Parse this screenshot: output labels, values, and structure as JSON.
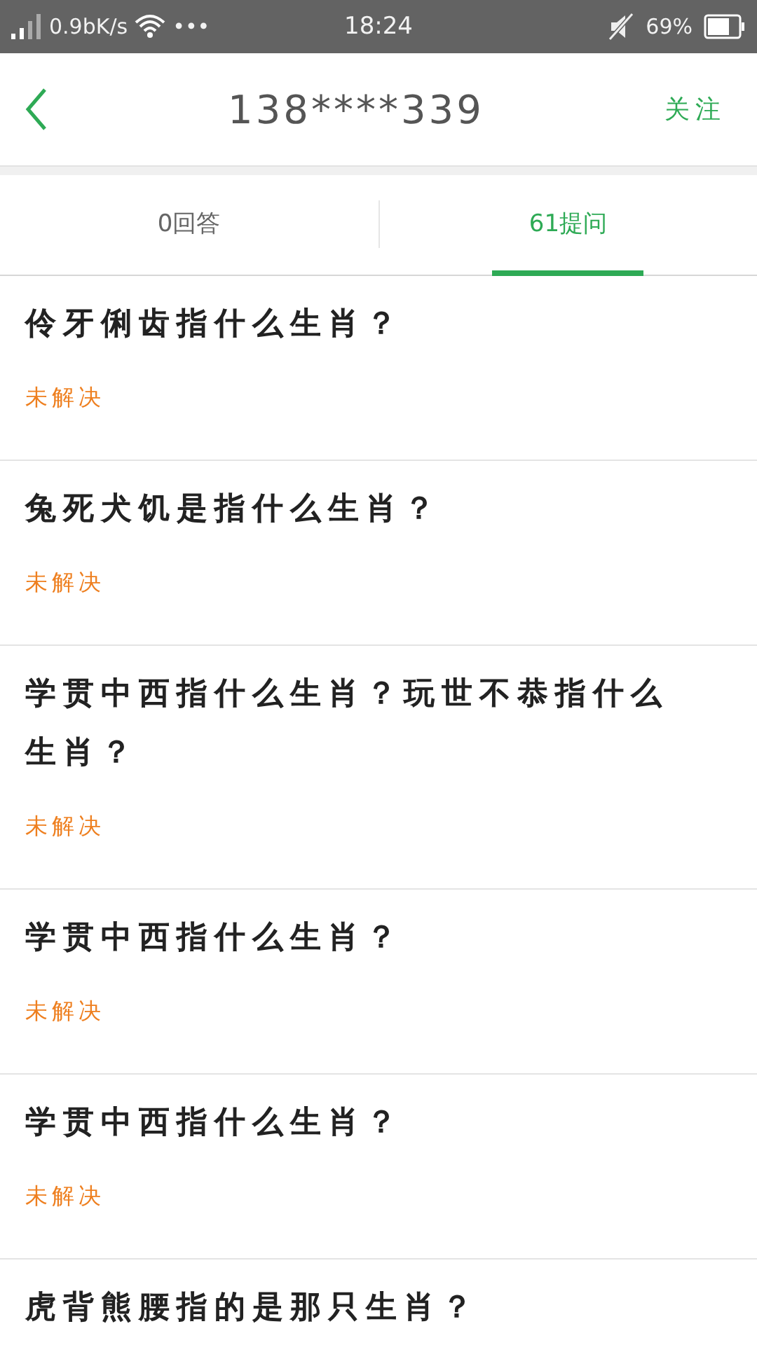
{
  "status_bar": {
    "network_speed": "0.9bK/s",
    "more": "•••",
    "time": "18:24",
    "battery": "69%"
  },
  "header": {
    "title": "138****339",
    "action": "关注"
  },
  "tabs": [
    {
      "label": "0回答",
      "selected": false
    },
    {
      "label": "61提问",
      "selected": true
    }
  ],
  "questions": [
    {
      "title": "伶牙俐齿指什么生肖？",
      "status": "未解决"
    },
    {
      "title": "兔死犬饥是指什么生肖？",
      "status": "未解决"
    },
    {
      "title": "学贯中西指什么生肖？玩世不恭指什么生肖？",
      "status": "未解决"
    },
    {
      "title": "学贯中西指什么生肖？",
      "status": "未解决"
    },
    {
      "title": "学贯中西指什么生肖？",
      "status": "未解决"
    },
    {
      "title": "虎背熊腰指的是那只生肖？"
    }
  ]
}
